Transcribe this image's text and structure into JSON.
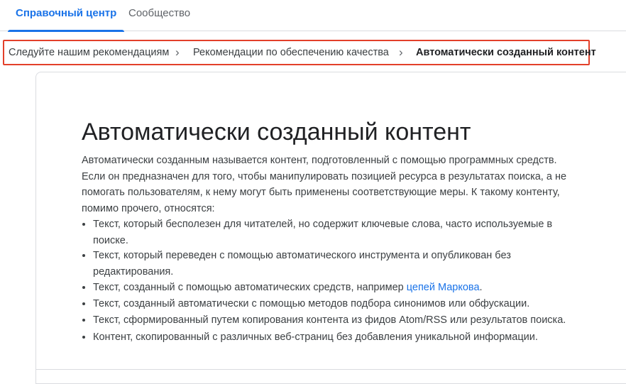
{
  "tabs": [
    {
      "label": "Справочный центр",
      "active": true
    },
    {
      "label": "Сообщество",
      "active": false
    }
  ],
  "breadcrumb": {
    "items": [
      "Следуйте нашим рекомендациям",
      "Рекомендации по обеспечению качества",
      "Автоматически созданный контент"
    ],
    "separator": "›"
  },
  "article": {
    "title": "Автоматически созданный контент",
    "intro": "Автоматически созданным называется контент, подготовленный с помощью программных средств.  Если он предназначен для того, чтобы манипулировать позицией ресурса в результатах поиска, а не помогать пользователям, к нему могут быть применены соответствующие меры. К такому контенту, помимо прочего, относятся:",
    "bullets": [
      "Текст, который бесполезен для читателей, но содержит ключевые слова, часто используемые в поиске.",
      "Текст, который переведен с помощью автоматического инструмента и опубликован без редактирования.",
      "Текст, созданный с помощью автоматических средств, например ",
      "Текст, созданный автоматически с помощью методов подбора синонимов или обфускации.",
      "Текст, сформированный путем копирования контента из фидов Atom/RSS или результатов поиска.",
      "Контент, скопированный с различных веб-страниц без добавления уникальной информации."
    ],
    "bullet3_link": "цепей Маркова",
    "bullet3_end": "."
  },
  "colors": {
    "accent": "#1a73e8",
    "highlight_border": "#e3402a"
  }
}
